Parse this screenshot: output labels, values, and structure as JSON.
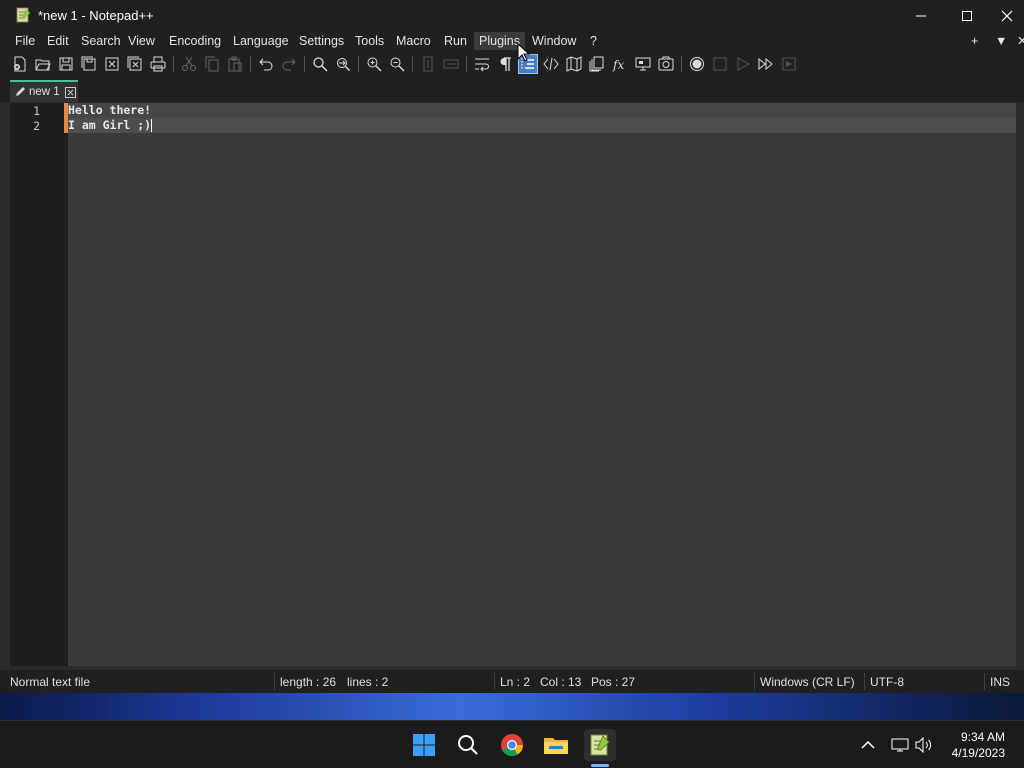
{
  "window": {
    "title": "*new 1 - Notepad++",
    "controls": [
      "minimize-icon",
      "maximize-icon",
      "close-icon"
    ]
  },
  "menu": {
    "items": [
      "File",
      "Edit",
      "Search",
      "View",
      "Encoding",
      "Language",
      "Settings",
      "Tools",
      "Macro",
      "Run",
      "Plugins",
      "Window",
      "?"
    ],
    "active": "Plugins",
    "right_controls": [
      "+",
      "▼",
      "✕"
    ]
  },
  "toolbar": {
    "buttons": [
      "new-file-icon",
      "open-file-icon",
      "save-icon",
      "save-all-icon",
      "close-icon",
      "close-all-icon",
      "print-icon",
      "cut-icon",
      "copy-icon",
      "paste-icon",
      "undo-icon",
      "redo-icon",
      "find-icon",
      "replace-icon",
      "zoom-in-icon",
      "zoom-out-icon",
      "sync-vertical-icon",
      "sync-horizontal-icon",
      "word-wrap-icon",
      "show-all-characters-icon",
      "indent-guide-icon",
      "xml-tag-icon",
      "document-map-icon",
      "document-list-icon",
      "function-list-icon",
      "folder-as-workspace-icon",
      "monitoring-icon",
      "record-macro-icon",
      "stop-recording-icon",
      "play-macro-icon",
      "run-macro-multiple-icon",
      "save-macro-icon"
    ],
    "highlighted": "indent-guide-icon"
  },
  "tabs": [
    {
      "label": "new 1",
      "modified": true
    }
  ],
  "editor": {
    "lines": [
      {
        "number": "1",
        "text": "Hello there!"
      },
      {
        "number": "2",
        "text": "I am Girl ;)"
      }
    ]
  },
  "status": {
    "file_type": "Normal text file",
    "length": "length : 26",
    "lines": "lines : 2",
    "ln": "Ln : 2",
    "col": "Col : 13",
    "pos": "Pos : 27",
    "eol": "Windows (CR LF)",
    "encoding": "UTF-8",
    "mode": "INS"
  },
  "taskbar": {
    "apps": [
      "windows-start-icon",
      "search-icon",
      "chrome-icon",
      "file-explorer-icon",
      "notepadpp-icon"
    ],
    "active_app": "notepadpp-icon",
    "tray": [
      "chevron-up-icon",
      "network-icon",
      "volume-icon"
    ],
    "time": "9:34 AM",
    "date": "4/19/2023"
  },
  "colors": {
    "accent_tab": "#4fbf9a",
    "change_marker": "#e8893d",
    "editor_bg": "#3a3a3a",
    "chrome_bg": "#202020"
  }
}
